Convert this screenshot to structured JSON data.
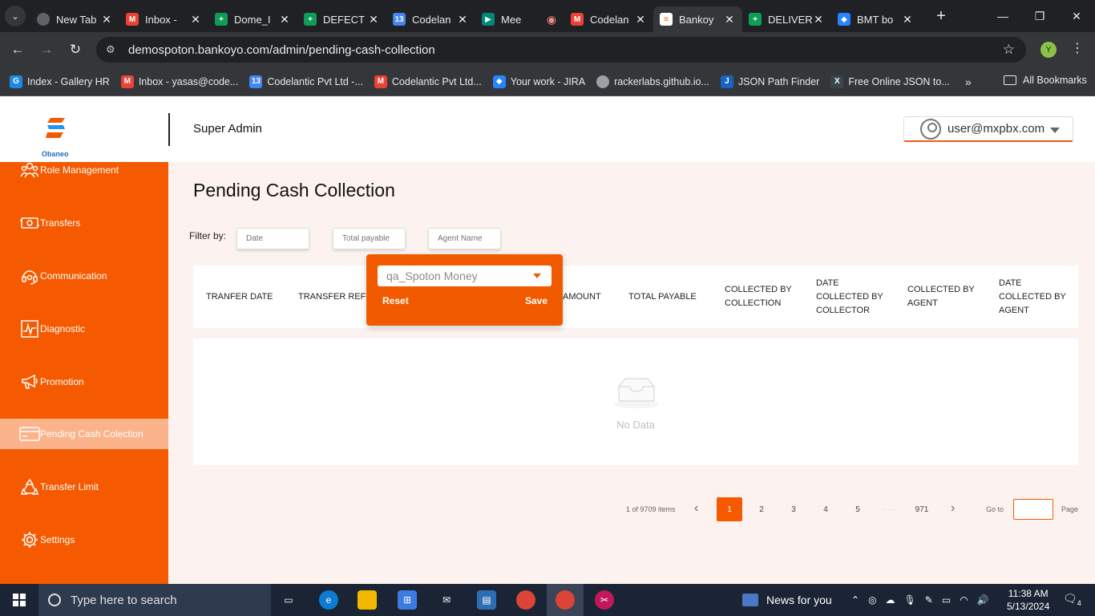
{
  "browser": {
    "tabs": [
      {
        "title": "New Tab",
        "icon": "chrome-icon",
        "color": "#5f6368"
      },
      {
        "title": "Inbox - ",
        "icon": "gmail-icon",
        "color": "#ea4335"
      },
      {
        "title": "Dome_I",
        "icon": "sheets-icon",
        "color": "#0f9d58"
      },
      {
        "title": "DEFECT",
        "icon": "sheets-icon",
        "color": "#0f9d58"
      },
      {
        "title": "Codelan",
        "icon": "calendar-icon",
        "color": "#4285f4"
      },
      {
        "title": "Mee",
        "icon": "meet-icon",
        "color": "#00897b"
      },
      {
        "title": "Codelan",
        "icon": "gmail-icon",
        "color": "#ea4335"
      },
      {
        "title": "Bankoy",
        "icon": "bankoyo-icon",
        "color": "#f25a00",
        "active": true
      },
      {
        "title": "DELIVER",
        "icon": "sheets-icon",
        "color": "#0f9d58"
      },
      {
        "title": "BMT bo",
        "icon": "jira-icon",
        "color": "#2684ff"
      }
    ],
    "url": "demospoton.bankoyo.com/admin/pending-cash-collection",
    "profile_initial": "Y",
    "bookmarks": [
      {
        "label": "Index - Gallery HR",
        "icon": "gallery-icon",
        "color": "#1e88e5"
      },
      {
        "label": "Inbox - yasas@code...",
        "icon": "gmail-icon",
        "color": "#ea4335"
      },
      {
        "label": "Codelantic Pvt Ltd -...",
        "icon": "calendar-icon",
        "color": "#4285f4"
      },
      {
        "label": "Codelantic Pvt Ltd...",
        "icon": "gmail-icon",
        "color": "#ea4335"
      },
      {
        "label": "Your work - JIRA",
        "icon": "jira-icon",
        "color": "#2684ff"
      },
      {
        "label": "rackerlabs.github.io...",
        "icon": "globe-icon",
        "color": "#9aa0a6"
      },
      {
        "label": "JSON Path Finder",
        "icon": "json-icon",
        "color": "#1565c0"
      },
      {
        "label": "Free Online JSON to...",
        "icon": "xml-icon",
        "color": "#37474f"
      }
    ],
    "all_bookmarks": "All Bookmarks"
  },
  "header": {
    "logo_text": "Obaneo",
    "title": "Super Admin",
    "user_email": "user@mxpbx.com"
  },
  "sidebar": {
    "items": [
      {
        "label": "Role Management",
        "icon": "users-icon"
      },
      {
        "label": "Transfers",
        "icon": "money-transfer-icon"
      },
      {
        "label": "Communication",
        "icon": "headset-icon"
      },
      {
        "label": "Diagnostic",
        "icon": "pulse-icon"
      },
      {
        "label": "Promotion",
        "icon": "megaphone-icon"
      },
      {
        "label": "Pending Cash Colection",
        "icon": "card-icon",
        "active": true
      },
      {
        "label": "Transfer Limit",
        "icon": "recycle-icon"
      },
      {
        "label": "Settings",
        "icon": "gear-icon"
      }
    ]
  },
  "main": {
    "title": "Pending Cash Collection",
    "filter_label": "Filter by:",
    "filters": [
      {
        "placeholder": "Date"
      },
      {
        "placeholder": "Total payable"
      },
      {
        "placeholder": "Agent Name"
      }
    ],
    "columns": [
      "TRANFER DATE",
      "TRANSFER REFER",
      "AMOUNT",
      "TOTAL PAYABLE",
      "COLLECTED BY COLLECTION",
      "DATE COLLECTED BY COLLECTOR",
      "COLLECTED BY AGENT",
      "DATE COLLECTED BY AGENT"
    ],
    "empty_text": "No Data",
    "pagination": {
      "total": "1 of 9709 items",
      "pages": [
        "1",
        "2",
        "3",
        "4",
        "5",
        "· · ·",
        "971"
      ],
      "current": "1",
      "goto_label": "Go to",
      "page_label": "Page"
    }
  },
  "popup": {
    "selected": "qa_Spoton Money",
    "reset_label": "Reset",
    "save_label": "Save"
  },
  "taskbar": {
    "search_placeholder": "Type here to search",
    "news": "News for you",
    "time": "11:38 AM",
    "date": "5/13/2024",
    "notifications": "4"
  },
  "colors": {
    "brand": "#f55a00",
    "active_item": "#fab38a",
    "page_bg": "#fcf3f0"
  }
}
